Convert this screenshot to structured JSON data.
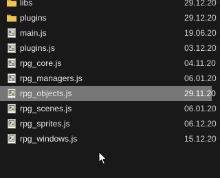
{
  "files": [
    {
      "name": "libs",
      "date": "29.12.20",
      "type": "folder",
      "icon": "folder-icon"
    },
    {
      "name": "plugins",
      "date": "29.12.20",
      "type": "folder",
      "icon": "folder-icon"
    },
    {
      "name": "main.js",
      "date": "19.06.20",
      "type": "js",
      "icon": "js-file-icon"
    },
    {
      "name": "plugins.js",
      "date": "03.12.20",
      "type": "js",
      "icon": "js-file-icon"
    },
    {
      "name": "rpg_core.js",
      "date": "04.11.20",
      "type": "js",
      "icon": "js-file-icon"
    },
    {
      "name": "rpg_managers.js",
      "date": "06.01.20",
      "type": "js",
      "icon": "js-file-icon"
    },
    {
      "name": "rpg_objects.js",
      "date": "29.11.20",
      "type": "js",
      "icon": "js-file-icon",
      "selected": true
    },
    {
      "name": "rpg_scenes.js",
      "date": "06.01.20",
      "type": "js",
      "icon": "js-file-icon"
    },
    {
      "name": "rpg_sprites.js",
      "date": "06.12.20",
      "type": "js",
      "icon": "js-file-icon"
    },
    {
      "name": "rpg_windows.js",
      "date": "15.12.20",
      "type": "js",
      "icon": "js-file-icon"
    }
  ],
  "colors": {
    "background": "#191919",
    "selection": "#777777",
    "folder": "#e9b84a",
    "text": "#e8e8e8"
  },
  "cursor_icon": "mouse-pointer-icon"
}
